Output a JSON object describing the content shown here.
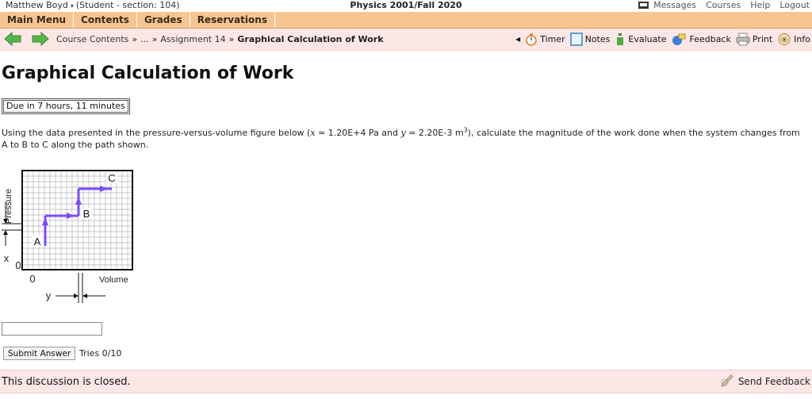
{
  "topbar": {
    "user": "Matthew Boyd",
    "user_caret": "▾",
    "section": "(Student  - section: 104)",
    "course": "Physics 2001/Fall 2020",
    "links": [
      "Messages",
      "Courses",
      "Help",
      "Logout"
    ]
  },
  "menubar": {
    "items": [
      "Main Menu",
      "Contents",
      "Grades",
      "Reservations"
    ]
  },
  "navbar": {
    "crumbs": {
      "course_contents": "Course Contents",
      "sep1": "»",
      "ellipsis": "...",
      "sep2": "»",
      "assignment": "Assignment 14",
      "sep3": "»",
      "current": "Graphical Calculation of Work"
    },
    "tools": [
      "Timer",
      "Notes",
      "Evaluate",
      "Feedback",
      "Print",
      "Info"
    ],
    "prev_marker": "◂"
  },
  "main": {
    "title": "Graphical Calculation of Work",
    "due": "Due in 7 hours, 11 minutes",
    "question_a": "Using the data presented in the pressure-versus-volume figure below (",
    "question_x": "x",
    "question_b": " = 1.20E+4 Pa and ",
    "question_y": "y",
    "question_c": " = 2.20E-3 m",
    "question_exp": "3",
    "question_d": "), calculate the magnitude of the work done when the system changes from A to B to C along the path shown.",
    "answer_value": "",
    "submit_label": "Submit Answer",
    "tries": "Tries 0/10"
  },
  "figure": {
    "pressure_label": "Pressure",
    "volume_label": "Volume",
    "zero_v": "0",
    "zero_h": "0",
    "x_label": "x",
    "y_label": "y",
    "point_a": "A",
    "point_b": "B",
    "point_c": "C",
    "path_color": "#7a4cff"
  },
  "footer": {
    "discussion": "This discussion is closed.",
    "send_feedback": "Send Feedback"
  },
  "colors": {
    "menubar": "#f6c591",
    "navbar": "#fde6e6",
    "arrow": "#55b64a"
  }
}
